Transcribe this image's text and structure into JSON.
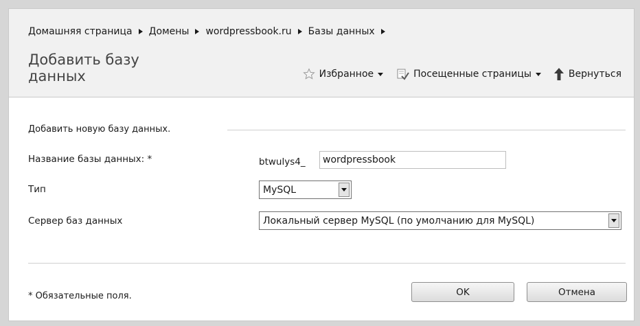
{
  "breadcrumb": [
    "Домашняя страница",
    "Домены",
    "wordpressbook.ru",
    "Базы данных"
  ],
  "page_title": "Добавить базу данных",
  "toolbar": {
    "favorites": {
      "label": "Избранное",
      "icon": "star-icon"
    },
    "visited": {
      "label": "Посещенные страницы",
      "icon": "visited-pages-icon"
    },
    "back": {
      "label": "Вернуться",
      "icon": "back-arrow-icon"
    }
  },
  "form": {
    "section_title": "Добавить новую базу данных.",
    "db_name": {
      "label": "Название базы данных: *",
      "prefix": "btwulys4_",
      "value": "wordpressbook"
    },
    "type": {
      "label": "Тип",
      "selected": "MySQL"
    },
    "server": {
      "label": "Сервер баз данных",
      "selected": "Локальный сервер MySQL (по умолчанию для MySQL)"
    },
    "required_note": "* Обязательные поля.",
    "ok_label": "OK",
    "cancel_label": "Отмена"
  }
}
